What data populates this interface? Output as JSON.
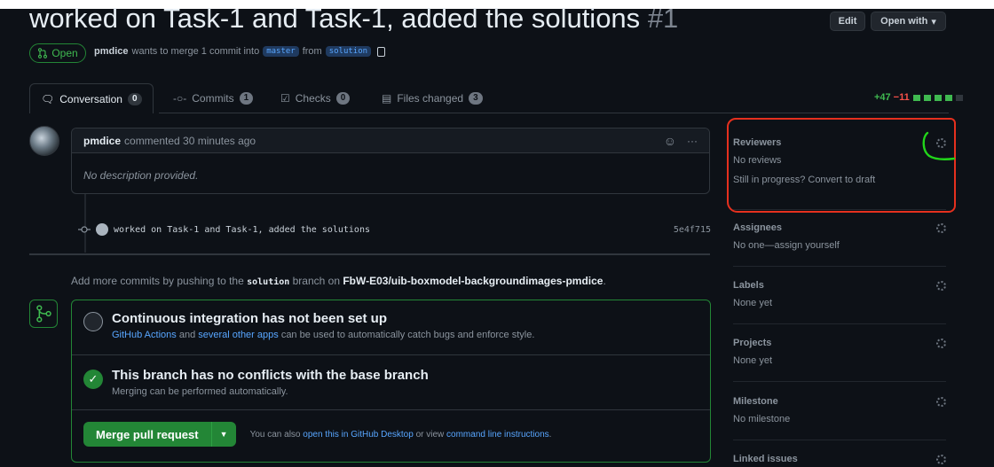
{
  "header": {
    "title": "worked on Task-1 and Task-1, added the solutions",
    "number": "#1",
    "edit_label": "Edit",
    "open_with_label": "Open with"
  },
  "status": {
    "state": "Open",
    "author": "pmdice",
    "merge_text": "wants to merge 1 commit into",
    "base_branch": "master",
    "from_text": "from",
    "head_branch": "solution"
  },
  "tabs": [
    {
      "label": "Conversation",
      "count": "0"
    },
    {
      "label": "Commits",
      "count": "1"
    },
    {
      "label": "Checks",
      "count": "0"
    },
    {
      "label": "Files changed",
      "count": "3"
    }
  ],
  "diffstat": {
    "additions": "+47",
    "deletions": "−11"
  },
  "comment": {
    "author": "pmdice",
    "action": "commented 30 minutes ago",
    "body": "No description provided."
  },
  "commit": {
    "message": "worked on Task-1 and Task-1, added the solutions",
    "sha": "5e4f715"
  },
  "add_more": {
    "prefix": "Add more commits by pushing to the",
    "branch": "solution",
    "middle": "branch on",
    "repo": "FbW-E03/uib-boxmodel-backgroundimages-pmdice",
    "suffix": "."
  },
  "mergebox": {
    "ci_title": "Continuous integration has not been set up",
    "ci_link1": "GitHub Actions",
    "ci_and": "and",
    "ci_link2": "several other apps",
    "ci_rest": "can be used to automatically catch bugs and enforce style.",
    "noconf_title": "This branch has no conflicts with the base branch",
    "noconf_sub": "Merging can be performed automatically.",
    "merge_label": "Merge pull request",
    "also_prefix": "You can also",
    "also_link1": "open this in GitHub Desktop",
    "also_mid": "or view",
    "also_link2": "command line instructions",
    "also_suffix": "."
  },
  "sidebar": {
    "reviewers_label": "Reviewers",
    "reviewers_value": "No reviews",
    "reviewers_draft": "Still in progress? Convert to draft",
    "assignees_label": "Assignees",
    "assignees_value": "No one—assign yourself",
    "labels_label": "Labels",
    "labels_value": "None yet",
    "projects_label": "Projects",
    "projects_value": "None yet",
    "milestone_label": "Milestone",
    "milestone_value": "No milestone",
    "linked_label": "Linked issues"
  },
  "colors": {
    "annotation_red": "#e5301e",
    "annotation_green": "#22d61a",
    "merge_green": "#238636"
  }
}
